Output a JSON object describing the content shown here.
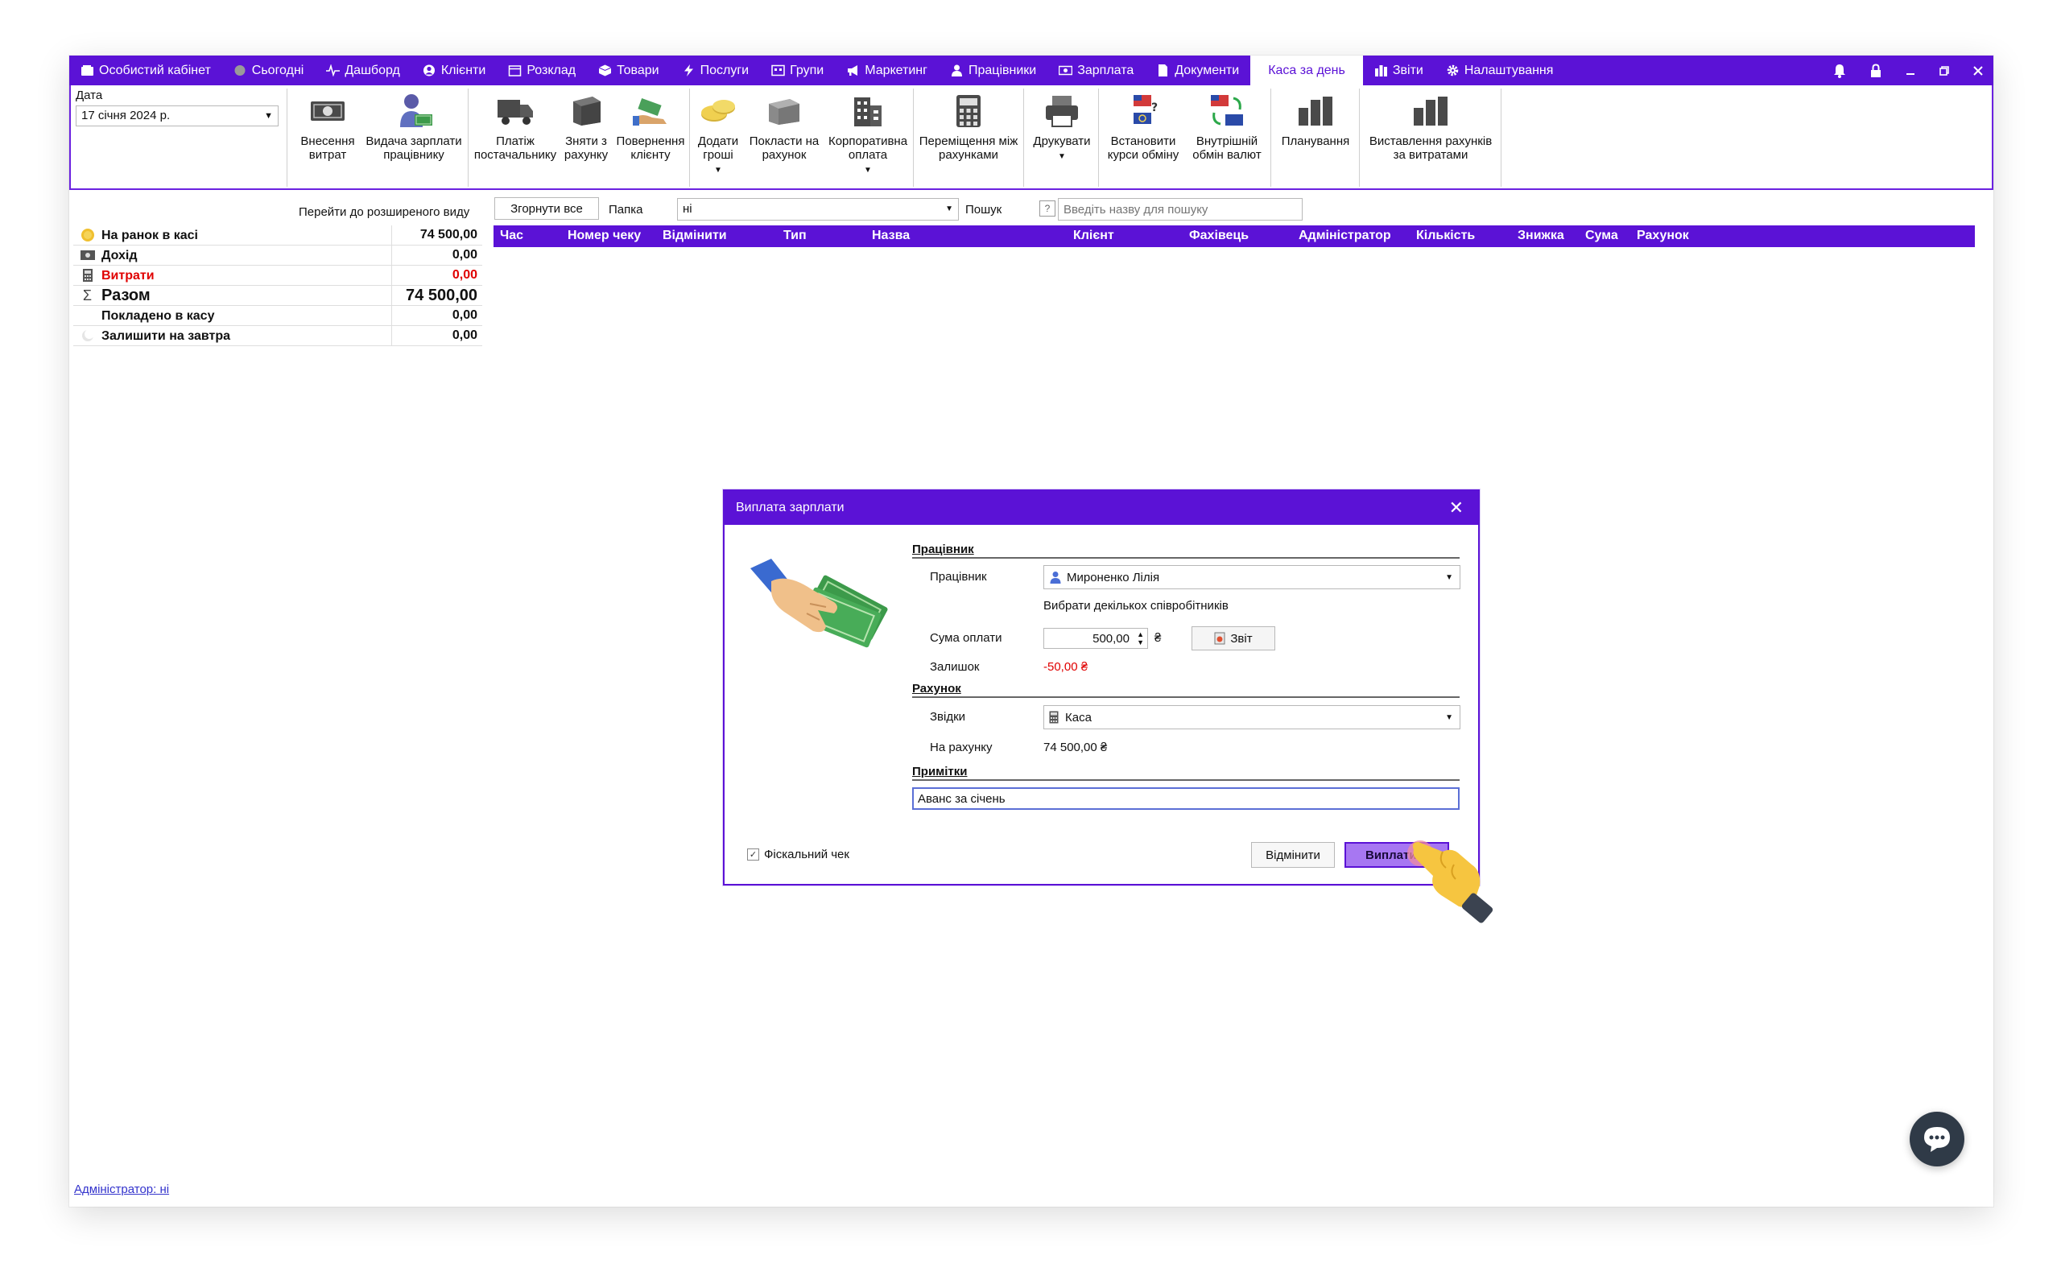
{
  "menu": {
    "items": [
      {
        "label": "Особистий кабінет",
        "icon": "wallet-icon"
      },
      {
        "label": "Сьогодні",
        "icon": "circle-icon"
      },
      {
        "label": "Дашборд",
        "icon": "pulse-icon"
      },
      {
        "label": "Клієнти",
        "icon": "user-circle-icon"
      },
      {
        "label": "Розклад",
        "icon": "calendar-icon"
      },
      {
        "label": "Товари",
        "icon": "box-icon"
      },
      {
        "label": "Послуги",
        "icon": "lightning-icon"
      },
      {
        "label": "Групи",
        "icon": "group-icon"
      },
      {
        "label": "Маркетинг",
        "icon": "megaphone-icon"
      },
      {
        "label": "Працівники",
        "icon": "person-icon"
      },
      {
        "label": "Зарплата",
        "icon": "banknote-icon"
      },
      {
        "label": "Документи",
        "icon": "document-icon"
      },
      {
        "label": "Каса за день",
        "icon": "",
        "active": true
      },
      {
        "label": "Звіти",
        "icon": "bars-icon"
      },
      {
        "label": "Налаштування",
        "icon": "gear-icon"
      }
    ]
  },
  "ribbon": {
    "date_label": "Дата",
    "date_value": "17 січня 2024 р.",
    "buttons": [
      {
        "l1": "Внесення",
        "l2": "витрат"
      },
      {
        "l1": "Видача зарплати",
        "l2": "працівнику"
      },
      {
        "l1": "Платіж",
        "l2": "постачальнику"
      },
      {
        "l1": "Зняти з",
        "l2": "рахунку"
      },
      {
        "l1": "Повернення",
        "l2": "клієнту"
      },
      {
        "l1": "Додати",
        "l2": "гроші"
      },
      {
        "l1": "Покласти на",
        "l2": "рахунок"
      },
      {
        "l1": "Корпоративна",
        "l2": "оплата"
      },
      {
        "l1": "Переміщення між",
        "l2": "рахунками"
      },
      {
        "l1": "Друкувати",
        "l2": ""
      },
      {
        "l1": "Встановити",
        "l2": "курси обміну"
      },
      {
        "l1": "Внутрішній",
        "l2": "обмін валют"
      },
      {
        "l1": "Планування",
        "l2": ""
      },
      {
        "l1": "Виставлення рахунків",
        "l2": "за витратами"
      }
    ]
  },
  "toolbar": {
    "extended_view_link": "Перейти до розширеного виду",
    "collapse_all": "Згорнути все",
    "folder_label": "Папка",
    "folder_value": "ні",
    "search_label": "Пошук",
    "help": "?",
    "search_placeholder": "Введіть назву для пошуку"
  },
  "summary": [
    {
      "label": "На ранок в касі",
      "value": "74 500,00"
    },
    {
      "label": "Дохід",
      "value": "0,00"
    },
    {
      "label": "Витрати",
      "value": "0,00"
    },
    {
      "label": "Разом",
      "value": "74 500,00"
    },
    {
      "label": "Покладено в касу",
      "value": "0,00"
    },
    {
      "label": "Залишити на завтра",
      "value": "0,00"
    }
  ],
  "summary_sigma": "Σ",
  "grid": {
    "columns": [
      "Час",
      "Номер чеку",
      "Відмінити",
      "Тип",
      "Назва",
      "Клієнт",
      "Фахівець",
      "Адміністратор",
      "Кількість",
      "Знижка",
      "Сума",
      "Рахунок"
    ]
  },
  "footer": {
    "admin_link": "Адміністратор: ні"
  },
  "dialog": {
    "title": "Виплата зарплати",
    "close": "✕",
    "employee_section": "Працівник",
    "employee_label": "Працівник",
    "employee_value": "Мироненко Лілія",
    "select_multiple": "Вибрати декількох співробітників",
    "amount_label": "Сума оплати",
    "amount_value": "500,00",
    "currency": "₴",
    "report_button": "Звіт",
    "balance_label": "Залишок",
    "balance_value": "-50,00 ₴",
    "account_section": "Рахунок",
    "from_label": "Звідки",
    "from_value": "Каса",
    "on_account_label": "На рахунку",
    "on_account_value": "74 500,00 ₴",
    "notes_section": "Примітки",
    "notes_value": "Аванс за січень",
    "fiscal_check_label": "Фіскальний чек",
    "fiscal_check_mark": "✓",
    "cancel_button": "Відмінити",
    "pay_button": "Виплатити"
  },
  "colors": {
    "accent": "#5b12d6",
    "negative": "#e00000",
    "pay_button": "#a777f2"
  }
}
